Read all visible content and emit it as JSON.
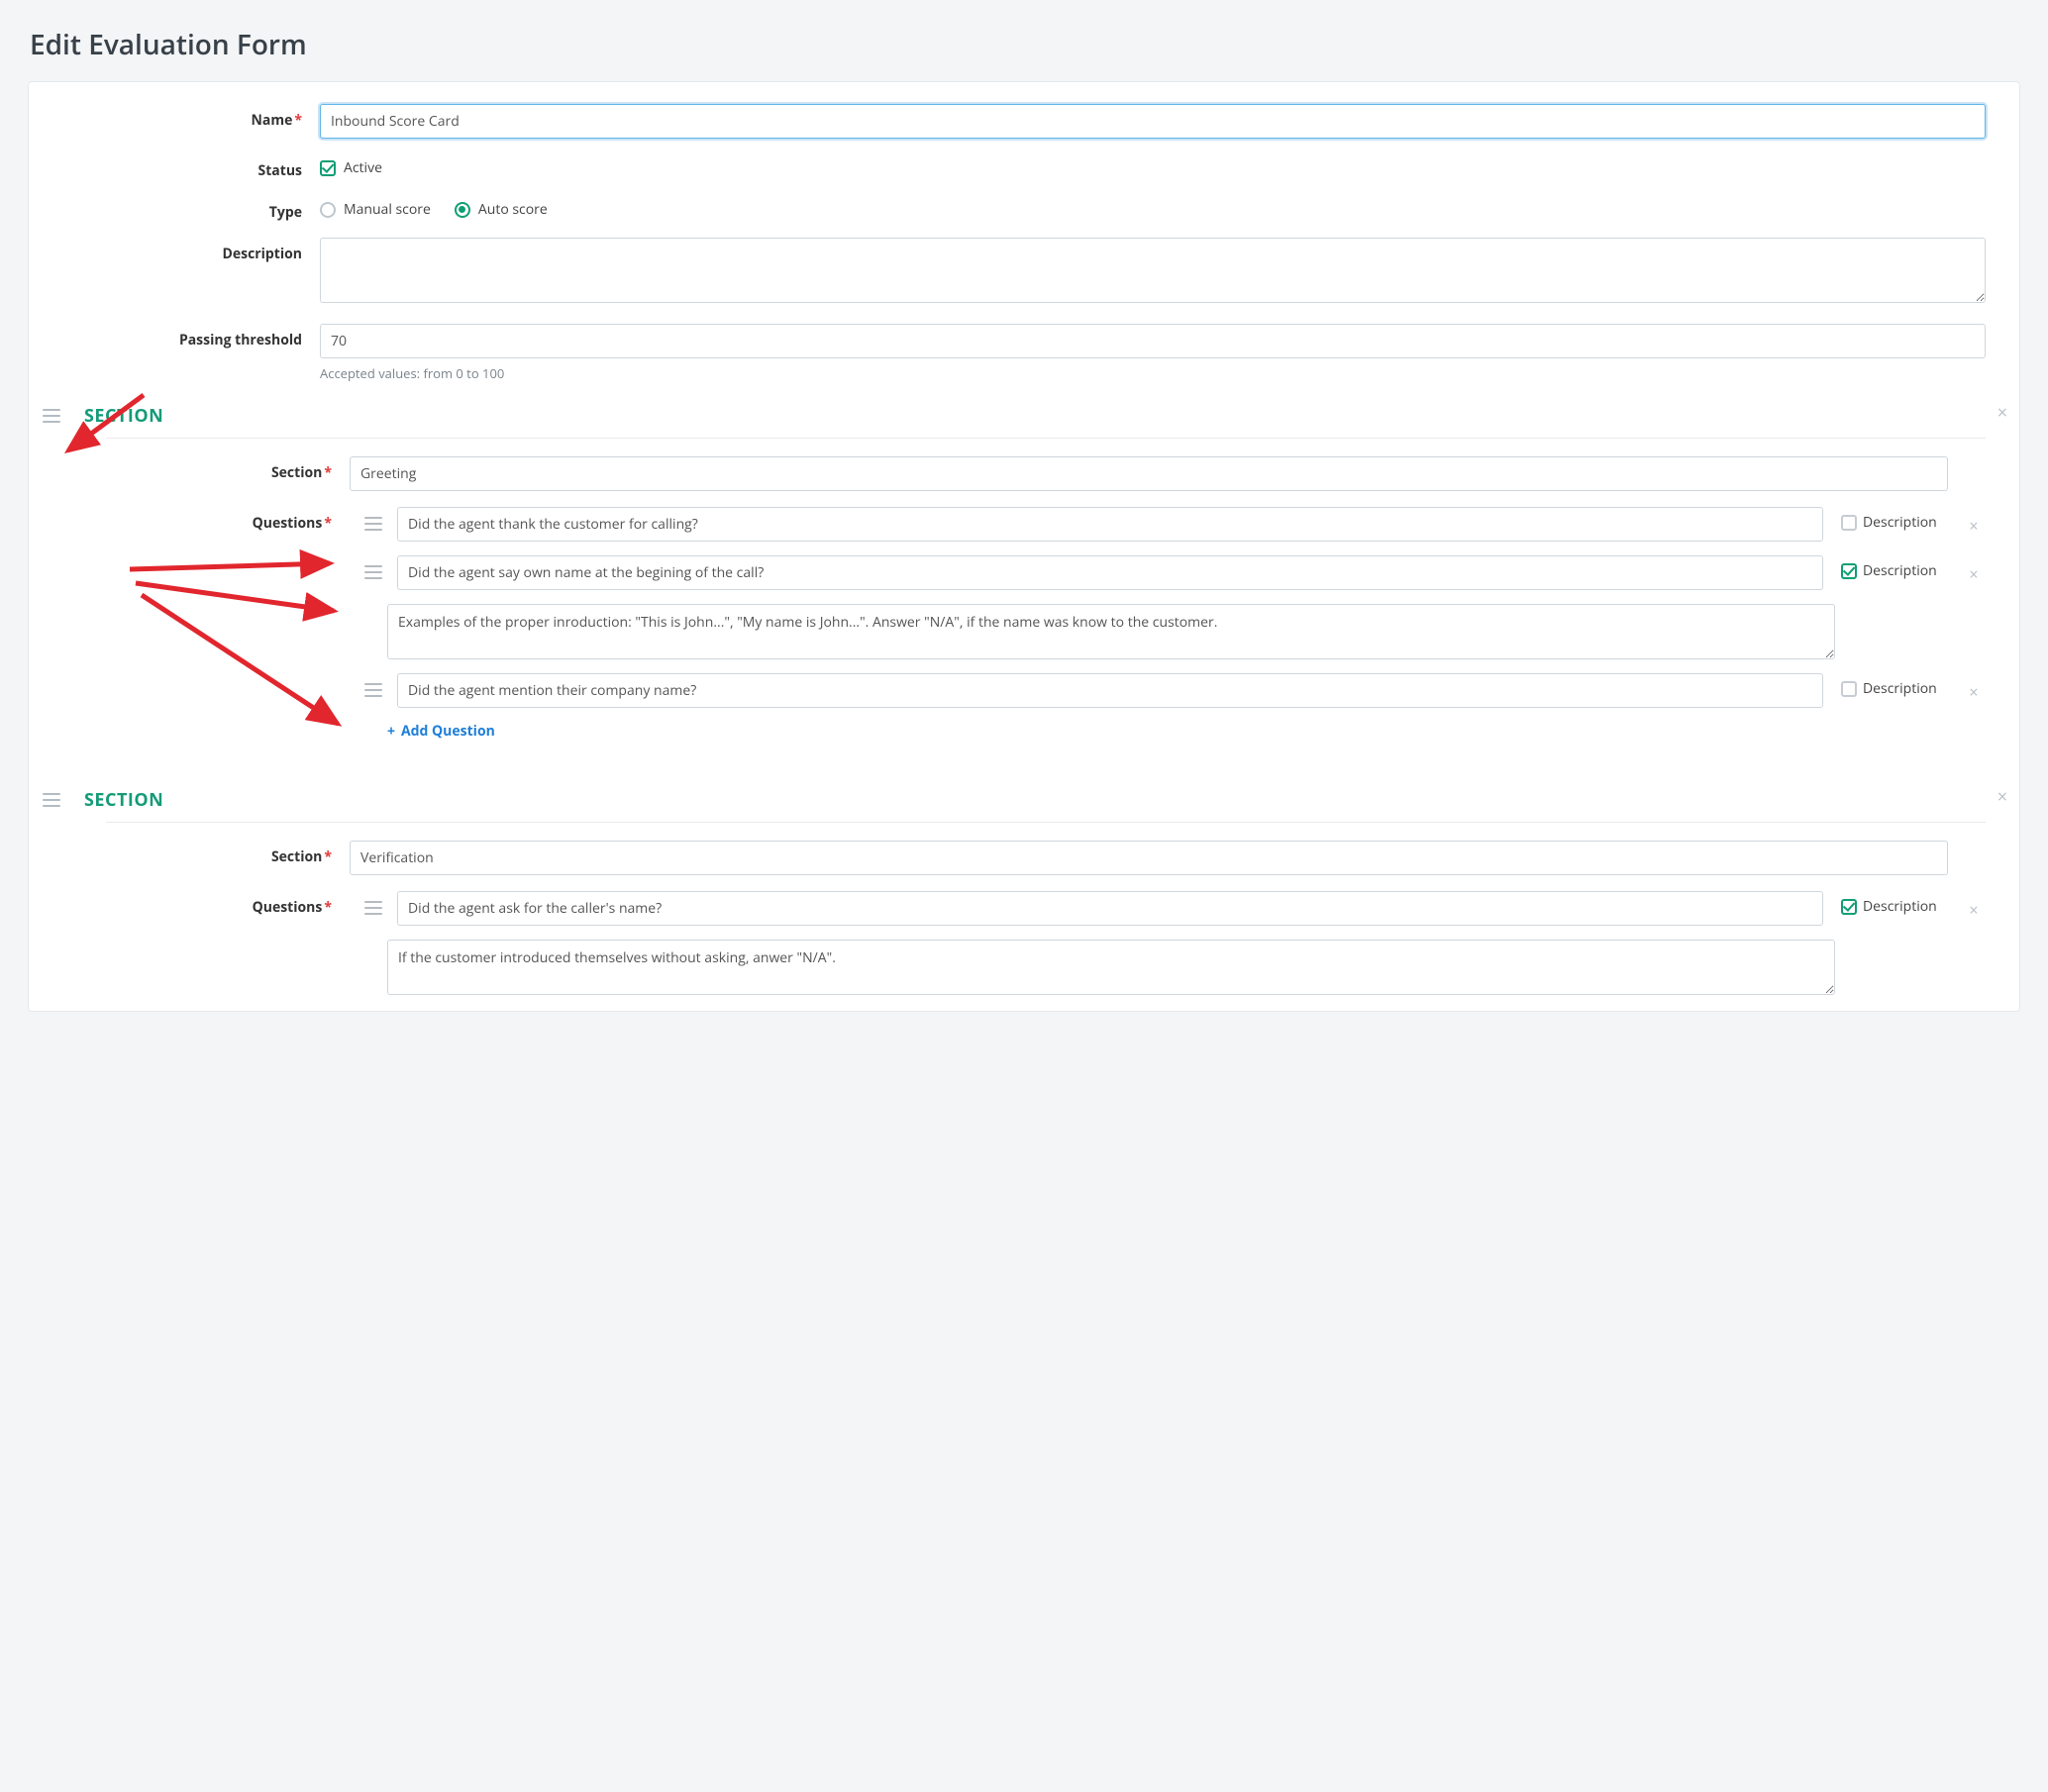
{
  "page_title": "Edit Evaluation Form",
  "labels": {
    "name": "Name",
    "status": "Status",
    "type": "Type",
    "description": "Description",
    "passing_threshold": "Passing threshold",
    "section_heading": "SECTION",
    "section_field": "Section",
    "questions": "Questions",
    "add_question": "Add Question",
    "description_checkbox": "Description"
  },
  "form": {
    "name": "Inbound Score Card",
    "status_active_label": "Active",
    "status_active": true,
    "type_manual_label": "Manual score",
    "type_auto_label": "Auto score",
    "type_selected": "auto",
    "description": "",
    "passing_threshold": "70",
    "passing_threshold_helper": "Accepted values: from 0 to 100"
  },
  "sections": [
    {
      "name": "Greeting",
      "questions": [
        {
          "text": "Did the agent thank the customer for calling?",
          "description_on": false,
          "description_text": ""
        },
        {
          "text": "Did the agent say own name at the begining of the call?",
          "description_on": true,
          "description_text": "Examples of the proper inroduction: \"This is John...\", \"My name is John...\". Answer \"N/A\", if the name was know to the customer."
        },
        {
          "text": "Did the agent mention their company name?",
          "description_on": false,
          "description_text": ""
        }
      ]
    },
    {
      "name": "Verification",
      "questions": [
        {
          "text": "Did the agent ask for the caller's name?",
          "description_on": true,
          "description_text": "If the customer introduced themselves without asking, anwer \"N/A\"."
        }
      ]
    }
  ]
}
